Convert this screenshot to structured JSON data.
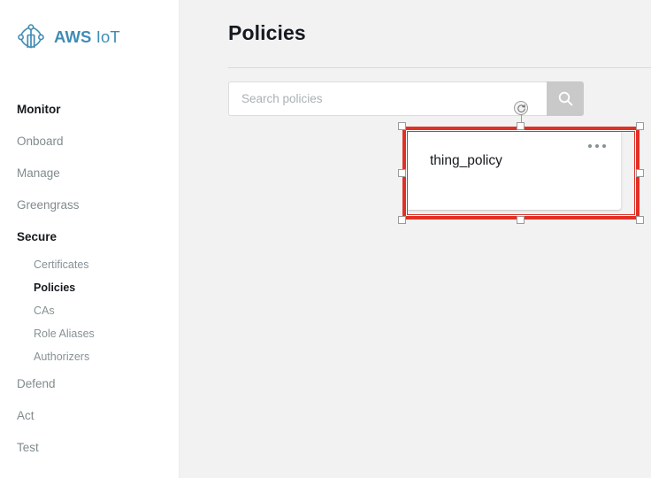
{
  "brand": {
    "logo_icon": "aws-iot-logo-icon",
    "name_bold": "AWS",
    "name_light": "IoT"
  },
  "sidebar": {
    "items": [
      {
        "label": "Monitor",
        "style": "top",
        "active": true
      },
      {
        "label": "Onboard",
        "style": "plain",
        "active": false
      },
      {
        "label": "Manage",
        "style": "plain",
        "active": false
      },
      {
        "label": "Greengrass",
        "style": "plain",
        "active": false
      },
      {
        "label": "Secure",
        "style": "group",
        "active": true
      },
      {
        "label": "Defend",
        "style": "plain",
        "active": false
      },
      {
        "label": "Act",
        "style": "plain",
        "active": false
      },
      {
        "label": "Test",
        "style": "plain",
        "active": false
      }
    ],
    "secure_subitems": [
      {
        "label": "Certificates",
        "active": false
      },
      {
        "label": "Policies",
        "active": true
      },
      {
        "label": "CAs",
        "active": false
      },
      {
        "label": "Role Aliases",
        "active": false
      },
      {
        "label": "Authorizers",
        "active": false
      }
    ]
  },
  "main": {
    "page_title": "Policies",
    "search": {
      "placeholder": "Search policies",
      "value": "",
      "button_icon": "search-icon"
    },
    "policy_card": {
      "name": "thing_policy",
      "menu_icon": "ellipsis-menu-icon"
    }
  },
  "selection": {
    "rotate_icon": "rotate-handle-icon",
    "color": "#e03127",
    "handle_fill": "#ffffff",
    "handle_border": "#9b9b9b"
  },
  "colors": {
    "brand_blue": "#3f8cb5",
    "page_background": "#f2f2f2",
    "sidebar_background": "#ffffff",
    "text_dark": "#16191f",
    "text_muted": "#879196",
    "search_button": "#c9c9c9",
    "divider": "#d5dbdb"
  }
}
